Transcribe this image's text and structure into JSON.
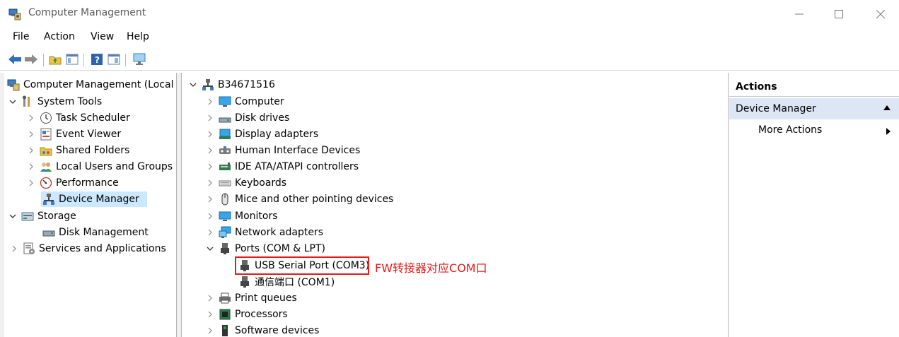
{
  "window": {
    "title": "Computer Management",
    "minimize_icon": "minimize-icon",
    "maximize_icon": "maximize-icon",
    "close_icon": "close-icon"
  },
  "menu": [
    "File",
    "Action",
    "View",
    "Help"
  ],
  "toolbar": [
    "back-arrow-icon",
    "forward-arrow-icon",
    "up-folder-icon",
    "show-hide-tree-icon",
    "help-icon",
    "properties-icon",
    "monitor-icon"
  ],
  "left_tree": {
    "root": "Computer Management (Local",
    "system_tools": "System Tools",
    "task_scheduler": "Task Scheduler",
    "event_viewer": "Event Viewer",
    "shared_folders": "Shared Folders",
    "local_users": "Local Users and Groups",
    "performance": "Performance",
    "device_manager": "Device Manager",
    "storage": "Storage",
    "disk_management": "Disk Management",
    "services_apps": "Services and Applications"
  },
  "device_tree": {
    "root": "B34671516",
    "computer": "Computer",
    "disk_drives": "Disk drives",
    "display_adapters": "Display adapters",
    "hid": "Human Interface Devices",
    "ide": "IDE ATA/ATAPI controllers",
    "keyboards": "Keyboards",
    "mice": "Mice and other pointing devices",
    "monitors": "Monitors",
    "network": "Network adapters",
    "ports": "Ports (COM & LPT)",
    "usb_serial": "USB Serial Port (COM3)",
    "comm_port": "通信端口 (COM1)",
    "print_queues": "Print queues",
    "processors": "Processors",
    "software_devices": "Software devices"
  },
  "annotation": "FW转接器对应COM口",
  "actions": {
    "header": "Actions",
    "group": "Device Manager",
    "more": "More Actions"
  },
  "colors": {
    "selection": "#cce8ff",
    "actions_group_bg": "#dce6f4",
    "annotation_red": "#e81919"
  }
}
